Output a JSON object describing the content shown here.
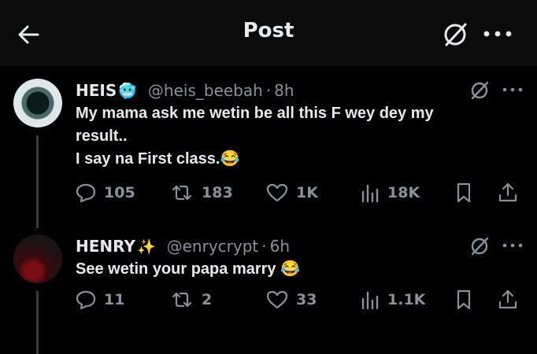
{
  "header": {
    "title": "Post",
    "back_icon": "arrow-left-icon",
    "grok_icon": "grok-icon",
    "more_icon": "more-horizontal-icon"
  },
  "tweets": [
    {
      "name": "HEIS",
      "name_emoji": "🥶",
      "handle": "@heis_beebah",
      "separator": "·",
      "time": "8h",
      "lines": [
        "My mama ask me wetin be all this F wey dey my",
        "result..",
        "I say na First class.😂"
      ],
      "replies": "105",
      "reposts": "183",
      "likes": "1K",
      "views": "18K"
    },
    {
      "name": "HENRY",
      "name_emoji": "✨",
      "handle": "@enrycrypt",
      "separator": "·",
      "time": "6h",
      "lines": [
        "See wetin your papa marry 😂"
      ],
      "replies": "11",
      "reposts": "2",
      "likes": "33",
      "views": "1.1K"
    }
  ]
}
